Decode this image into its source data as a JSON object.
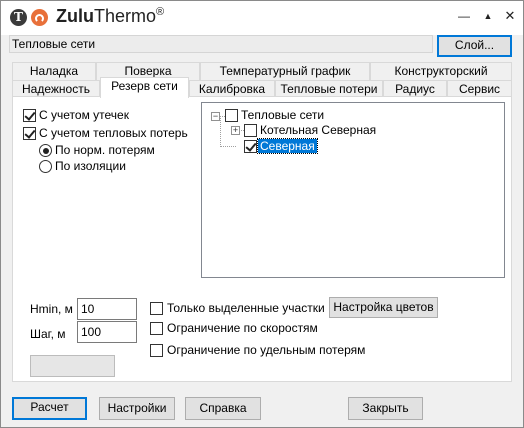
{
  "app": {
    "logo_letter": "T",
    "title_bold": "Zulu",
    "title_regular": "Thermo",
    "title_mark": "®"
  },
  "window_controls": {
    "minimize": "—",
    "maximize": "▲",
    "close": "✕"
  },
  "layer": {
    "name": "Тепловые сети",
    "button": "Слой..."
  },
  "tabs_row1": [
    "Наладка",
    "Поверка",
    "Температурный график",
    "Конструкторский"
  ],
  "tabs_row2": [
    "Надежность",
    "Резерв сети",
    "Калибровка",
    "Тепловые потери",
    "Радиус",
    "Сервис"
  ],
  "active_tab": "Резерв сети",
  "options": {
    "leaks": "С учетом утечек",
    "heat_losses": "С учетом тепловых потерь",
    "by_norm": "По норм. потерям",
    "by_insulation": "По изоляции"
  },
  "tree": {
    "root": "Тепловые сети",
    "child1": "Котельная Северная",
    "child2": "Северная"
  },
  "params": {
    "hmin_label": "Hmin, м",
    "hmin_value": "10",
    "step_label": "Шаг, м",
    "step_value": "100"
  },
  "filters": {
    "only_selected": "Только выделенные участки",
    "speed_limit": "Ограничение по скоростям",
    "specific_losses": "Ограничение по удельным потерям",
    "color_settings": "Настройка цветов"
  },
  "footer": {
    "calc": "Расчет",
    "settings": "Настройки",
    "help": "Справка",
    "close": "Закрыть"
  }
}
